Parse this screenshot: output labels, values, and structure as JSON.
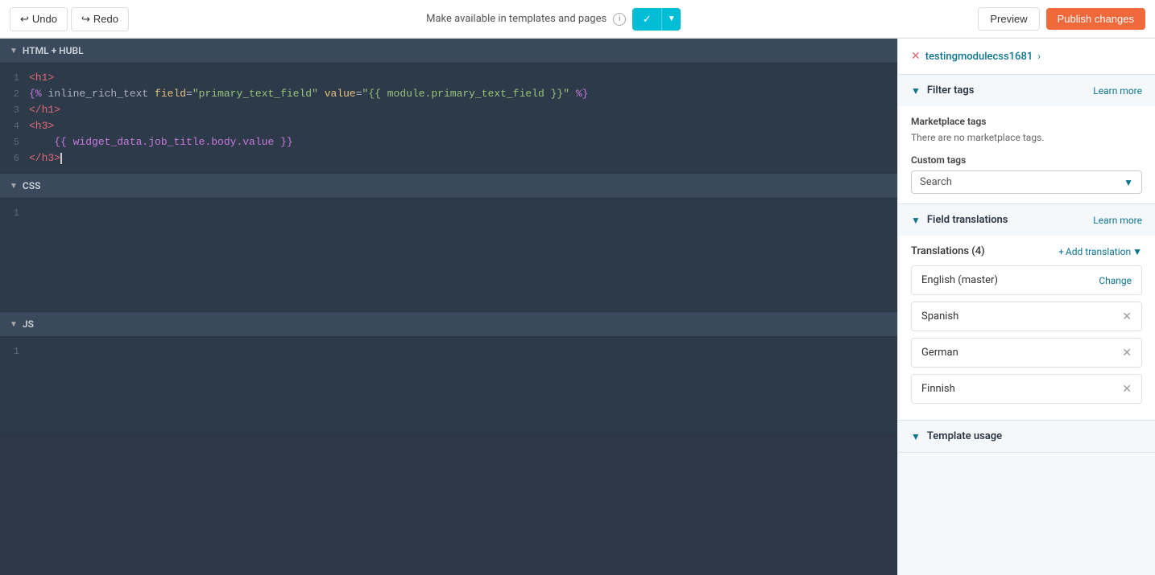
{
  "topbar": {
    "undo_label": "Undo",
    "redo_label": "Redo",
    "available_label": "Make available in templates and pages",
    "preview_label": "Preview",
    "publish_label": "Publish changes"
  },
  "editor": {
    "html_section_label": "HTML + HUBL",
    "css_section_label": "CSS",
    "js_section_label": "JS",
    "html_lines": [
      {
        "num": "1",
        "content": "<h1>"
      },
      {
        "num": "2",
        "content": "{% inline_rich_text field=\"primary_text_field\" value=\"{{ module.primary_text_field }}\" %}"
      },
      {
        "num": "3",
        "content": "</h1>"
      },
      {
        "num": "4",
        "content": "<h3>"
      },
      {
        "num": "5",
        "content": "    {{ widget_data.job_title.body.value }}"
      },
      {
        "num": "6",
        "content": "</h3>"
      }
    ],
    "css_lines": [
      {
        "num": "1",
        "content": ""
      }
    ],
    "js_lines": [
      {
        "num": "1",
        "content": ""
      }
    ]
  },
  "right_panel": {
    "module_name": "testingmodulecss1681",
    "filter_tags": {
      "section_title": "Filter tags",
      "learn_more": "Learn more",
      "marketplace_tags_title": "Marketplace tags",
      "marketplace_tags_empty": "There are no marketplace tags.",
      "custom_tags_title": "Custom tags",
      "search_placeholder": "Search"
    },
    "field_translations": {
      "section_title": "Field translations",
      "learn_more": "Learn more",
      "translations_label": "Translations (4)",
      "add_translation_label": "Add translation",
      "translations": [
        {
          "name": "English (master)",
          "action": "Change",
          "removable": false
        },
        {
          "name": "Spanish",
          "removable": true
        },
        {
          "name": "German",
          "removable": true
        },
        {
          "name": "Finnish",
          "removable": true
        }
      ]
    },
    "template_usage": {
      "section_title": "Template usage"
    }
  }
}
